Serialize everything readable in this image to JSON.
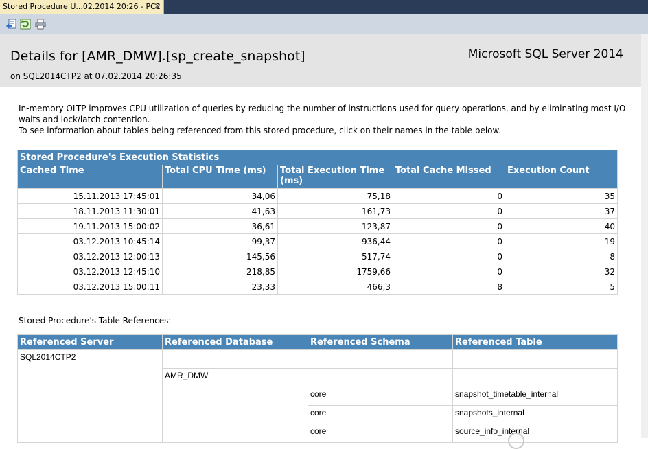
{
  "tab": {
    "title": "Stored Procedure U...02.2014 20:26 - PC2",
    "close": "✕"
  },
  "toolbar": {
    "buttons": [
      "back-icon",
      "refresh-icon",
      "print-icon"
    ]
  },
  "header": {
    "title": "Details for [AMR_DMW].[sp_create_snapshot]",
    "subtitle": "on SQL2014CTP2 at 07.02.2014 20:26:35",
    "brand": "Microsoft SQL Server 2014"
  },
  "intro": {
    "line1": "In-memory OLTP improves CPU utilization of queries by reducing the number of instructions used for query operations, and by eliminating most I/O waits and lock/latch contention.",
    "line2": "To see information about tables being referenced from this stored procedure, click on their names in the table below."
  },
  "exec_stats": {
    "caption": "Stored Procedure's Execution Statistics",
    "columns": [
      "Cached Time",
      "Total CPU Time (ms)",
      "Total Execution Time (ms)",
      "Total Cache Missed",
      "Execution Count"
    ],
    "rows": [
      [
        "15.11.2013 17:45:01",
        "34,06",
        "75,18",
        "0",
        "35"
      ],
      [
        "18.11.2013 11:30:01",
        "41,63",
        "161,73",
        "0",
        "37"
      ],
      [
        "19.11.2013 15:00:02",
        "36,61",
        "123,87",
        "0",
        "40"
      ],
      [
        "03.12.2013 10:45:14",
        "99,37",
        "936,44",
        "0",
        "19"
      ],
      [
        "03.12.2013 12:00:13",
        "145,56",
        "517,74",
        "0",
        "8"
      ],
      [
        "03.12.2013 12:45:10",
        "218,85",
        "1759,66",
        "0",
        "32"
      ],
      [
        "03.12.2013 15:00:11",
        "23,33",
        "466,3",
        "8",
        "5"
      ]
    ]
  },
  "table_refs": {
    "label": "Stored Procedure's Table References:",
    "columns": [
      "Referenced Server",
      "Referenced Database",
      "Referenced Schema",
      "Referenced Table"
    ],
    "server": "SQL2014CTP2",
    "database": "AMR_DMW",
    "tables": [
      {
        "schema": "core",
        "table": "snapshot_timetable_internal"
      },
      {
        "schema": "core",
        "table": "snapshots_internal"
      },
      {
        "schema": "core",
        "table": "source_info_internal"
      }
    ]
  }
}
